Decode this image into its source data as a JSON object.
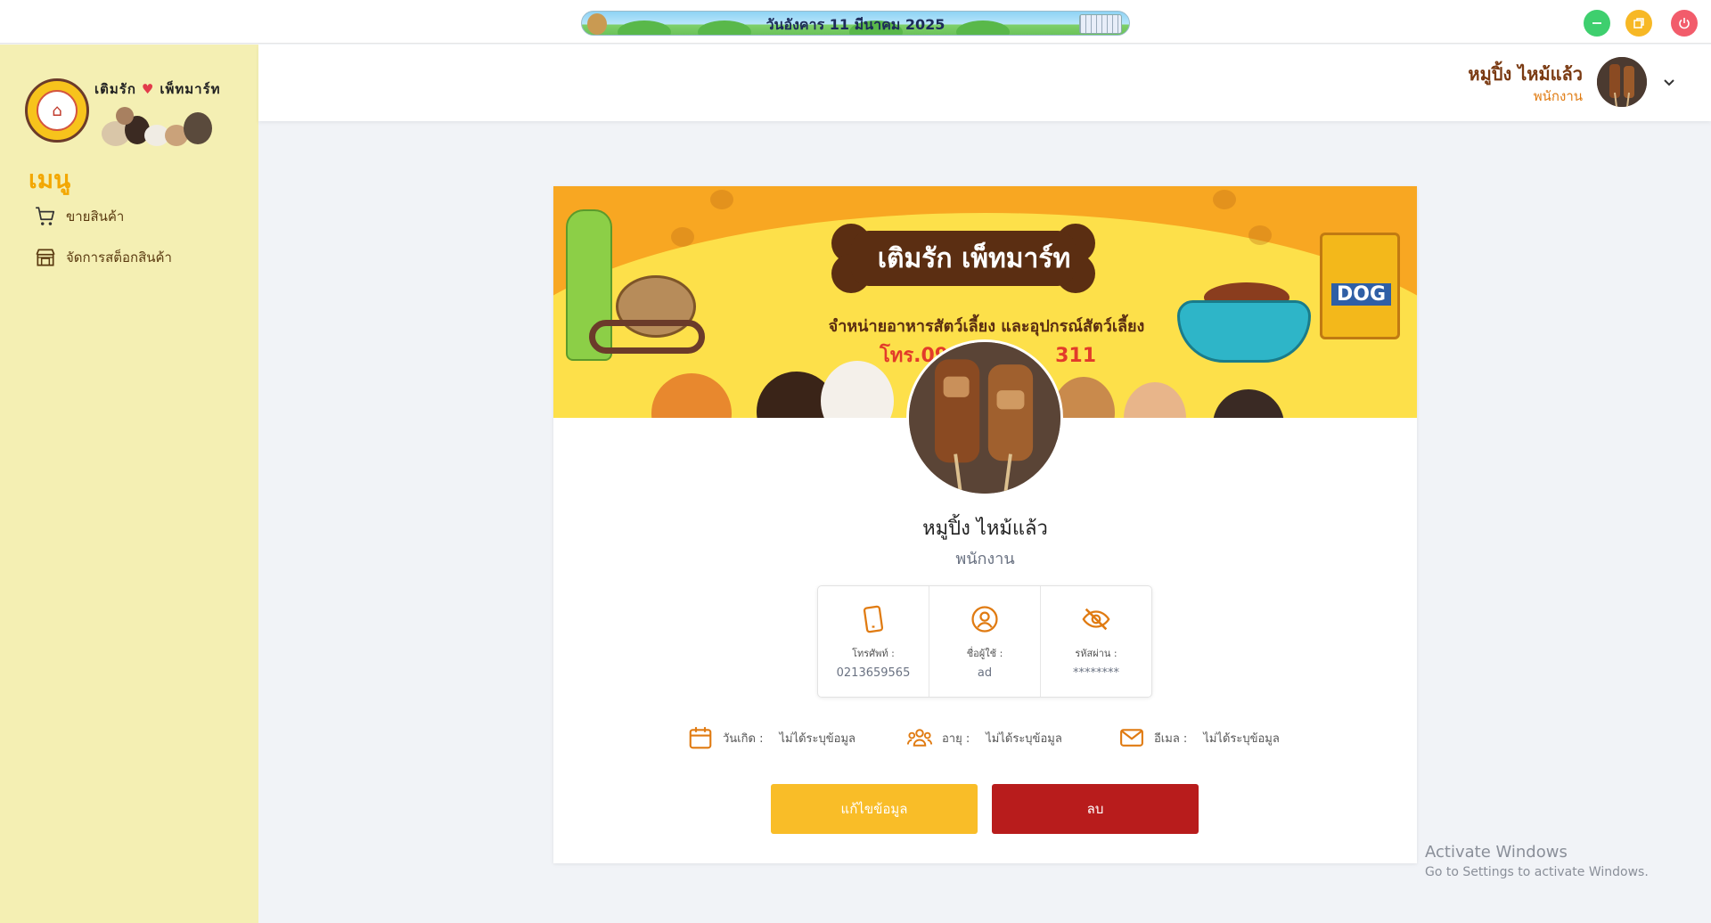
{
  "topbar": {
    "date_text": "วันอังคาร 11 มีนาคม 2025"
  },
  "sidebar": {
    "logo_title_left": "เติมรัก",
    "logo_title_right": "เพ็ทมาร์ท",
    "menu_title": "เมนู",
    "items": [
      {
        "label": "ขายสินค้า",
        "icon": "cart-icon"
      },
      {
        "label": "จัดการสต็อกสินค้า",
        "icon": "store-icon"
      }
    ]
  },
  "header": {
    "user_name": "หมูปิ้ง ไหม้แล้ว",
    "user_role": "พนักงาน"
  },
  "profile": {
    "banner": {
      "title": "เติมรัก เพ็ทมาร์ท",
      "subtitle": "จำหน่ายอาหารสัตว์เลี้ยง และอุปกรณ์สัตว์เลี้ยง",
      "phone": "โทร.09",
      "phone_suffix": "311",
      "bag_label": "DOG"
    },
    "name": "หมูปิ้ง ไหม้แล้ว",
    "role": "พนักงาน",
    "info": [
      {
        "label": "โทรศัพท์ :",
        "value": "0213659565",
        "icon": "phone-icon"
      },
      {
        "label": "ชื่อผู้ใช้ :",
        "value": "ad",
        "icon": "user-circle-icon"
      },
      {
        "label": "รหัสผ่าน :",
        "value": "********",
        "icon": "eye-off-icon"
      }
    ],
    "details": [
      {
        "label": "วันเกิด :",
        "value": "ไม่ได้ระบุข้อมูล",
        "icon": "calendar-icon"
      },
      {
        "label": "อายุ :",
        "value": "ไม่ได้ระบุข้อมูล",
        "icon": "users-icon"
      },
      {
        "label": "อีเมล :",
        "value": "ไม่ได้ระบุข้อมูล",
        "icon": "mail-icon"
      }
    ],
    "edit_label": "แก้ไขข้อมูล",
    "delete_label": "ลบ"
  },
  "watermark": {
    "line1": "Activate Windows",
    "line2": "Go to Settings to activate Windows."
  },
  "colors": {
    "accent_orange": "#e07b12",
    "menu_yellow": "#f3a700",
    "sidebar_bg": "#f4efb3",
    "edit_button": "#f9bd28",
    "delete_button": "#b81c1c"
  }
}
